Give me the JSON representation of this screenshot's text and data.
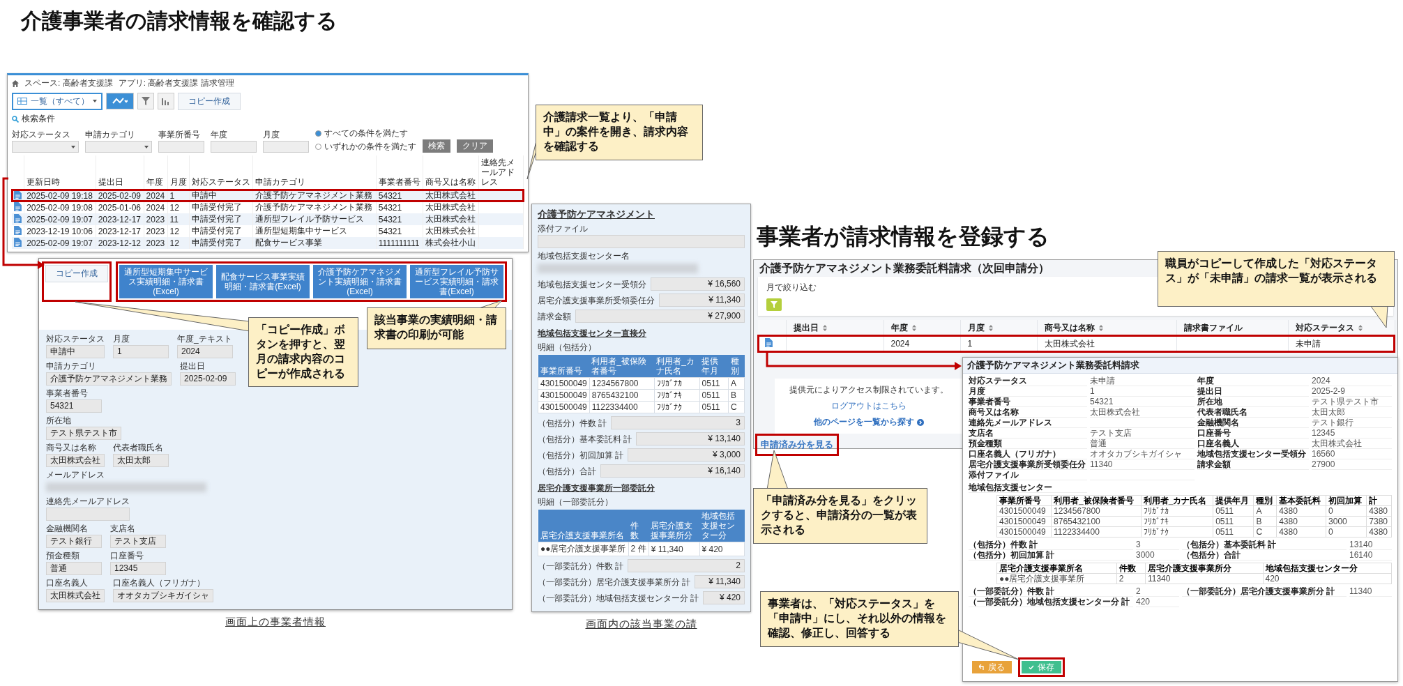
{
  "page_title": "介護事業者の請求情報を確認する",
  "list_screen": {
    "breadcrumb": [
      "スペース: 高齢者支援課",
      "アプリ: 高齢者支援課 請求管理"
    ],
    "view_select": "一覧（すべて）",
    "copy_button": "コピー作成",
    "search_heading": "検索条件",
    "filters": [
      {
        "label": "対応ステータス",
        "kind": "select"
      },
      {
        "label": "申請カテゴリ",
        "kind": "select"
      },
      {
        "label": "事業所番号",
        "kind": "text"
      },
      {
        "label": "年度",
        "kind": "text"
      },
      {
        "label": "月度",
        "kind": "text"
      }
    ],
    "match_options": [
      {
        "label": "すべての条件を満たす",
        "selected": true
      },
      {
        "label": "いずれかの条件を満たす",
        "selected": false
      }
    ],
    "search_button": "検索",
    "clear_button": "クリア",
    "columns": [
      "更新日時",
      "提出日",
      "年度",
      "月度",
      "対応ステータス",
      "申請カテゴリ",
      "事業者番号",
      "商号又は名称",
      "連絡先メールアドレス"
    ],
    "rows": [
      {
        "cells": [
          "2025-02-09 19:18",
          "2025-02-09",
          "2024",
          "1",
          "申請中",
          "介護予防ケアマネジメント業務",
          "54321",
          "太田株式会社"
        ],
        "highlighted": true
      },
      {
        "cells": [
          "2025-02-09 19:08",
          "2025-01-06",
          "2024",
          "12",
          "申請受付完了",
          "介護予防ケアマネジメント業務",
          "54321",
          "太田株式会社"
        ],
        "highlighted": false
      },
      {
        "cells": [
          "2025-02-09 19:07",
          "2023-12-17",
          "2023",
          "11",
          "申請受付完了",
          "通所型フレイル予防サービス",
          "54321",
          "太田株式会社"
        ],
        "highlighted": false
      },
      {
        "cells": [
          "2023-12-19 10:06",
          "2023-12-17",
          "2023",
          "12",
          "申請受付完了",
          "通所型短期集中サービス",
          "54321",
          "太田株式会社"
        ],
        "highlighted": false
      },
      {
        "cells": [
          "2025-02-09 19:07",
          "2023-12-12",
          "2023",
          "12",
          "申請受付完了",
          "配食サービス事業",
          "1111111111",
          "株式会社小山"
        ],
        "highlighted": false
      }
    ]
  },
  "detail_screen": {
    "copy_button": "コピー作成",
    "copy_highlighted": true,
    "excel_buttons": [
      "通所型短期集中サービス実績明細・請求書(Excel)",
      "配食サービス事業実績明細・請求書(Excel)",
      "介護予防ケアマネジメント実績明細・請求書(Excel)",
      "通所型フレイル予防サービス実績明細・請求書(Excel)"
    ],
    "excel_highlighted": true,
    "field_rows": [
      [
        {
          "label": "対応ステータス",
          "value": "申請中"
        },
        {
          "label": "月度",
          "value": "1"
        },
        {
          "label": "年度_テキスト",
          "value": "2024"
        }
      ],
      [
        {
          "label": "申請カテゴリ",
          "value": "介護予防ケアマネジメント業務"
        },
        {
          "label": "提出日",
          "value": "2025-02-09"
        }
      ],
      [
        {
          "label": "事業者番号",
          "value": "54321"
        }
      ],
      [
        {
          "label": "所在地",
          "value": "テスト県テスト市"
        }
      ],
      [
        {
          "label": "商号又は名称",
          "value": "太田株式会社"
        },
        {
          "label": "代表者職氏名",
          "value": "太田太郎"
        }
      ],
      [
        {
          "label": "メールアドレス",
          "blurred": true
        }
      ],
      [
        {
          "label": "連絡先メールアドレス"
        }
      ],
      [
        {
          "label": "金融機関名",
          "value": "テスト銀行"
        },
        {
          "label": "支店名",
          "value": "テスト支店"
        }
      ],
      [
        {
          "label": "預金種類",
          "value": "普通"
        },
        {
          "label": "口座番号",
          "value": "12345"
        }
      ],
      [
        {
          "label": "口座名義人",
          "value": "太田株式会社"
        },
        {
          "label": "口座名義人（フリガナ）",
          "value": "オオタカブシキガイシャ"
        }
      ]
    ]
  },
  "left_caption": "画面上の事業者情報",
  "invoice_screen": {
    "title": "介護予防ケアマネジメント",
    "fields": [
      {
        "label": "添付ファイル"
      },
      {
        "label": "地域包括支援センター名",
        "blurred": true
      }
    ],
    "amounts": [
      {
        "label": "地域包括支援センター受領分",
        "value": "¥ 16,560"
      },
      {
        "label": "居宅介護支援事業所受領委任分",
        "value": "¥ 11,340"
      },
      {
        "label": "請求金額",
        "value": "¥ 27,900"
      }
    ],
    "sections": [
      {
        "title": "地域包括支援センター直接分",
        "caption": "明細（包括分）",
        "columns": [
          "事業所番号",
          "利用者_被保険者番号",
          "利用者_カナ氏名",
          "提供年月",
          "種別"
        ],
        "rows": [
          [
            "4301500049",
            "1234567800",
            "ﾌﾘｶﾞﾅｶ",
            "0511",
            "A"
          ],
          [
            "4301500049",
            "8765432100",
            "ﾌﾘｶﾞﾅｷ",
            "0511",
            "B"
          ],
          [
            "4301500049",
            "1122334400",
            "ﾌﾘｶﾞﾅｸ",
            "0511",
            "C"
          ]
        ],
        "sums": [
          {
            "label": "（包括分）件数 計",
            "value": "3"
          },
          {
            "label": "（包括分）基本委託料 計",
            "value": "¥ 13,140"
          },
          {
            "label": "（包括分）初回加算 計",
            "value": "¥ 3,000"
          },
          {
            "label": "（包括分）合計",
            "value": "¥ 16,140"
          }
        ]
      },
      {
        "title": "居宅介護支援事業所一部委託分",
        "caption": "明細（一部委託分）",
        "columns": [
          "居宅介護支援事業所名",
          "件数",
          "居宅介護支援事業所分",
          "地域包括支援センター分"
        ],
        "rows": [
          [
            "●●居宅介護支援事業所",
            "2 件",
            "¥ 11,340",
            "¥ 420"
          ]
        ],
        "sums": [
          {
            "label": "（一部委託分）件数 計",
            "value": "2"
          },
          {
            "label": "（一部委託分）居宅介護支援事業所分 計",
            "value": "¥ 11,340"
          },
          {
            "label": "（一部委託分）地域包括支援センター分 計",
            "value": "¥ 420"
          }
        ]
      }
    ]
  },
  "middle_caption": "画面内の該当事業の請",
  "right_heading": "事業者が請求情報を登録する",
  "request_screen": {
    "title": "介護予防ケアマネジメント業務委託料請求（次回申請分）",
    "filter_label": "月で絞り込む",
    "columns": [
      {
        "label": "提出日",
        "sortable": true
      },
      {
        "label": "年度",
        "sortable": true
      },
      {
        "label": "月度",
        "sortable": true
      },
      {
        "label": "商号又は名称",
        "sortable": true
      },
      {
        "label": "請求書ファイル",
        "sortable": false
      },
      {
        "label": "対応ステータス",
        "sortable": true
      }
    ],
    "rows": [
      {
        "cells": [
          null,
          "2024",
          "1",
          "太田株式会社",
          null,
          "未申請"
        ],
        "highlighted": true
      }
    ],
    "notice": "提供元によりアクセス制限されています。",
    "logout_link": "ログアウトはこちら",
    "browse_link": "他のページを一覧から探す",
    "submitted_link": "申請済み分を見る",
    "submitted_highlighted": true
  },
  "form_screen": {
    "title": "介護予防ケアマネジメント業務委託料請求",
    "fields": [
      {
        "label": "対応ステータス",
        "value": "未申請"
      },
      {
        "label": "年度",
        "value": "2024"
      },
      {
        "label": "月度",
        "value": "1"
      },
      {
        "label": "提出日",
        "value": "2025-2-9"
      },
      {
        "label": "事業者番号",
        "value": "54321"
      },
      {
        "label": "所在地",
        "value": "テスト県テスト市"
      },
      {
        "label": "商号又は名称",
        "value": "太田株式会社"
      },
      {
        "label": "代表者職氏名",
        "value": "太田太郎"
      },
      {
        "label": "連絡先メールアドレス"
      },
      {
        "label": "金融機関名",
        "value": "テスト銀行"
      },
      {
        "label": "支店名",
        "value": "テスト支店"
      },
      {
        "label": "口座番号",
        "value": "12345"
      },
      {
        "label": "預金種類",
        "value": "普通"
      },
      {
        "label": "口座名義人",
        "value": "太田株式会社"
      },
      {
        "label": "口座名義人（フリガナ）",
        "value": "オオタカブシキガイシャ"
      },
      {
        "label": "地域包括支援センター受領分",
        "value": "16560"
      },
      {
        "label": "居宅介護支援事業所受領委任分",
        "value": "11340"
      },
      {
        "label": "請求金額",
        "value": "27900"
      },
      {
        "label": "添付ファイル"
      }
    ],
    "center_label": "地域包括支援センター",
    "tables": [
      {
        "columns": [
          "事業所番号",
          "利用者_被保険者番号",
          "利用者_カナ氏名",
          "提供年月",
          "種別",
          "基本委託料",
          "初回加算",
          "計"
        ],
        "rows": [
          [
            "4301500049",
            "1234567800",
            "ﾌﾘｶﾞﾅｶ",
            "0511",
            "A",
            "4380",
            "0",
            "4380"
          ],
          [
            "4301500049",
            "8765432100",
            "ﾌﾘｶﾞﾅｷ",
            "0511",
            "B",
            "4380",
            "3000",
            "7380"
          ],
          [
            "4301500049",
            "1122334400",
            "ﾌﾘｶﾞﾅｸ",
            "0511",
            "C",
            "4380",
            "0",
            "4380"
          ]
        ],
        "sums": [
          {
            "label": "（包括分）件数 計",
            "value": "3"
          },
          {
            "label": "（包括分）基本委託料 計",
            "value": "13140"
          },
          {
            "label": "（包括分）初回加算 計",
            "value": "3000"
          },
          {
            "label": "（包括分）合計",
            "value": "16140"
          }
        ]
      },
      {
        "columns": [
          "居宅介護支援事業所名",
          "件数",
          "居宅介護支援事業所分",
          "地域包括支援センター分"
        ],
        "rows": [
          [
            "●●居宅介護支援事業所",
            "2",
            "11340",
            "420"
          ]
        ],
        "sums": [
          {
            "label": "（一部委託分）件数 計",
            "value": "2"
          },
          {
            "label": "（一部委託分）居宅介護支援事業所分 計",
            "value": "11340"
          },
          {
            "label": "（一部委託分）地域包括支援センター分 計",
            "value": "420"
          }
        ]
      }
    ],
    "buttons": [
      {
        "label": "戻る",
        "kind": "back",
        "highlighted": false
      },
      {
        "label": "保存",
        "kind": "save",
        "highlighted": true
      }
    ]
  },
  "callouts": [
    {
      "text": "介護請求一覧より、「申請中」の案件を開き、請求内容を確認する"
    },
    {
      "text": "該当事業の実績明細・請求書の印刷が可能"
    },
    {
      "text": "「コピー作成」ボタンを押すと、翌月の請求内容のコピーが作成される"
    },
    {
      "text": "職員がコピーして作成した「対応ステータス」が「未申請」の請求一覧が表示される"
    },
    {
      "text": "「申請済み分を見る」をクリックすると、申請済分の一覧が表示される"
    },
    {
      "text": "事業者は、「対応ステータス」を「申請中」にし、それ以外の情報を確認、修正し、回答する"
    }
  ]
}
